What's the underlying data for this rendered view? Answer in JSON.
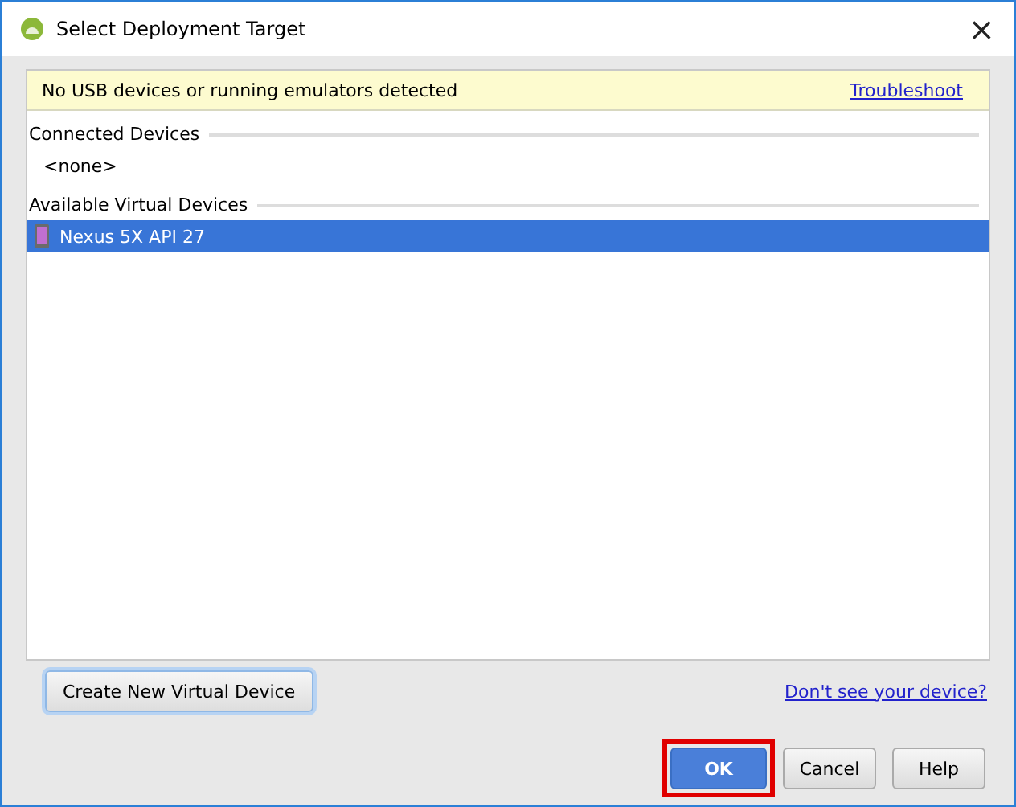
{
  "window": {
    "title": "Select Deployment Target",
    "close": "×"
  },
  "banner": {
    "message": "No USB devices or running emulators detected",
    "link": "Troubleshoot"
  },
  "groups": [
    {
      "heading": "Connected Devices",
      "items": [
        {
          "kind": "placeholder",
          "label": "<none>",
          "selected": false
        }
      ]
    },
    {
      "heading": "Available Virtual Devices",
      "items": [
        {
          "kind": "device",
          "label": "Nexus 5X API 27",
          "selected": true
        }
      ]
    }
  ],
  "create_button": "Create New Virtual Device",
  "help_link": "Don't see your device?",
  "buttons": [
    {
      "label": "OK",
      "primary": true,
      "highlighted": true
    },
    {
      "label": "Cancel",
      "primary": false,
      "highlighted": false
    },
    {
      "label": "Help",
      "primary": false,
      "highlighted": false
    }
  ]
}
